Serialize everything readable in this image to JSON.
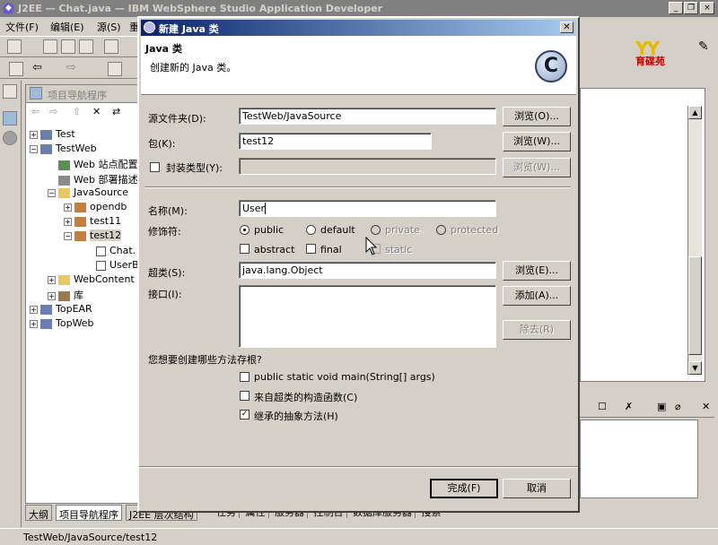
{
  "window": {
    "title": "J2EE — Chat.java — IBM WebSphere Studio Application Developer"
  },
  "menu": [
    "文件(F)",
    "编辑(E)",
    "源(S)",
    "重"
  ],
  "logo_text": "育碟苑",
  "navigator": {
    "title": "项目导航程序",
    "tree": [
      {
        "label": "Test",
        "expander": "+",
        "icon": "project-icon"
      },
      {
        "label": "TestWeb",
        "expander": "−",
        "icon": "project-icon"
      },
      {
        "label": "Web 站点配置",
        "expander": "",
        "icon": "site-icon"
      },
      {
        "label": "Web 部署描述",
        "expander": "",
        "icon": "deploy-icon"
      },
      {
        "label": "JavaSource",
        "expander": "−",
        "icon": "folder-icon"
      },
      {
        "label": "opendb",
        "expander": "+",
        "icon": "package-icon"
      },
      {
        "label": "test11",
        "expander": "+",
        "icon": "package-icon"
      },
      {
        "label": "test12",
        "expander": "−",
        "icon": "package-icon"
      },
      {
        "label": "Chat.",
        "expander": "",
        "icon": "java-file-icon"
      },
      {
        "label": "UserB",
        "expander": "",
        "icon": "java-file-icon"
      },
      {
        "label": "WebContent",
        "expander": "+",
        "icon": "folder-icon"
      },
      {
        "label": "库",
        "expander": "+",
        "icon": "library-icon"
      },
      {
        "label": "TopEAR",
        "expander": "+",
        "icon": "project-icon"
      },
      {
        "label": "TopWeb",
        "expander": "+",
        "icon": "project-icon"
      }
    ]
  },
  "left_tabs": [
    "大纲",
    "项目导航程序",
    "J2EE 层次结构"
  ],
  "bottom_tabs": [
    "任务",
    "属性",
    "服务器",
    "控制台",
    "数据库服务器",
    "搜索"
  ],
  "status_bar": "TestWeb/JavaSource/test12",
  "dialog": {
    "title": "新建 Java 类",
    "heading": "Java 类",
    "description": "创建新的 Java 类。",
    "banner_icon_letter": "C",
    "source_folder": {
      "label": "源文件夹(D):",
      "value": "TestWeb/JavaSource",
      "button": "浏览(O)..."
    },
    "package": {
      "label": "包(K):",
      "value": "test12",
      "button": "浏览(W)..."
    },
    "enclosing": {
      "label": "封装类型(Y):",
      "value": "",
      "button": "浏览(W)...",
      "checked": false
    },
    "name": {
      "label": "名称(M):",
      "value": "User"
    },
    "modifiers": {
      "label": "修饰符:",
      "access": [
        {
          "label": "public",
          "selected": true,
          "enabled": true
        },
        {
          "label": "default",
          "selected": false,
          "enabled": true
        },
        {
          "label": "private",
          "selected": false,
          "enabled": false
        },
        {
          "label": "protected",
          "selected": false,
          "enabled": false
        }
      ],
      "other": [
        {
          "label": "abstract",
          "checked": false,
          "enabled": true
        },
        {
          "label": "final",
          "checked": false,
          "enabled": true
        },
        {
          "label": "static",
          "checked": false,
          "enabled": false
        }
      ]
    },
    "superclass": {
      "label": "超类(S):",
      "value": "java.lang.Object",
      "button": "浏览(E)..."
    },
    "interfaces": {
      "label": "接口(I):",
      "add_button": "添加(A)...",
      "remove_button": "除去(R)"
    },
    "stubs": {
      "question": "您想要创建哪些方法存根?",
      "options": [
        {
          "label": "public static void main(String[] args)",
          "checked": false
        },
        {
          "label": "来自超类的构造函数(C)",
          "checked": false
        },
        {
          "label": "继承的抽象方法(H)",
          "checked": true
        }
      ]
    },
    "finish_button": "完成(F)",
    "cancel_button": "取消"
  }
}
